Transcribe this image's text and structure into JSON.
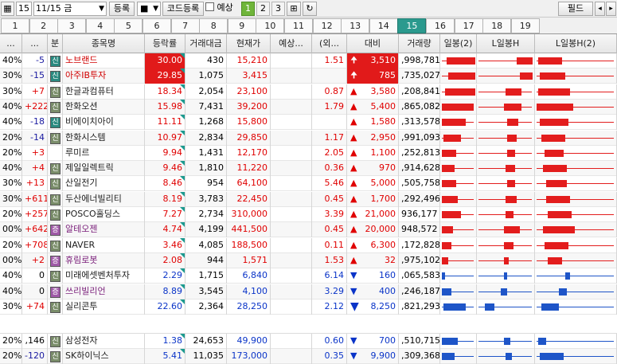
{
  "toolbar": {
    "num": "15",
    "date": "11/15 금",
    "reg": "등록",
    "code_reg": "코드등록",
    "forecast": "예상",
    "pages": [
      "1",
      "2",
      "3"
    ],
    "field": "필드",
    "nav_left": "◂",
    "nav_right": "▸"
  },
  "tabs": [
    "1",
    "2",
    "3",
    "4",
    "5",
    "6",
    "7",
    "8",
    "9",
    "10",
    "11",
    "12",
    "13",
    "14",
    "15",
    "16",
    "17",
    "18",
    "19"
  ],
  "active_tab": "15",
  "headers": [
    "...",
    "...",
    "분",
    "종목명",
    "등락률",
    "거래대금",
    "현재가",
    "예상...",
    "(외...",
    "대비",
    "거래량",
    "일봉(2)",
    "L일봉H",
    "L일봉H(2)"
  ],
  "rows": [
    {
      "a": "40%",
      "b": "-5",
      "t": "신",
      "tc": "g",
      "name": "노브랜드",
      "rate": "30.00",
      "amt": "430",
      "price": "15,210",
      "exp": "",
      "frn": "1.51",
      "arr": "up2",
      "chg": "3,510",
      "vol": ",998,781",
      "rb": true,
      "cls": "up"
    },
    {
      "a": "30%",
      "b": "-15",
      "t": "신",
      "tc": "g",
      "name": "아주IB투자",
      "rate": "29.85",
      "amt": "1,075",
      "price": "3,415",
      "exp": "",
      "frn": "",
      "arr": "up2",
      "chg": "785",
      "vol": ",735,027",
      "rb": true,
      "cls": "up"
    },
    {
      "a": "30%",
      "b": "+7",
      "t": "신",
      "tc": "",
      "name": "한글과컴퓨터",
      "rate": "18.34",
      "amt": "2,054",
      "price": "23,100",
      "exp": "",
      "frn": "0.87",
      "arr": "up",
      "chg": "3,580",
      "vol": ",208,841",
      "rb": false,
      "cls": "up"
    },
    {
      "a": "40%",
      "b": "+222",
      "t": "신",
      "tc": "",
      "name": "한화오션",
      "rate": "15.98",
      "amt": "7,431",
      "price": "39,200",
      "exp": "",
      "frn": "1.79",
      "arr": "up",
      "chg": "5,400",
      "vol": ",865,082",
      "rb": false,
      "cls": "up"
    },
    {
      "a": "40%",
      "b": "-18",
      "t": "신",
      "tc": "g",
      "name": "비에이치아이",
      "rate": "11.11",
      "amt": "1,268",
      "price": "15,800",
      "exp": "",
      "frn": "",
      "arr": "up",
      "chg": "1,580",
      "vol": ",313,578",
      "rb": false,
      "cls": "up"
    },
    {
      "a": "20%",
      "b": "-14",
      "t": "신",
      "tc": "",
      "name": "한화시스템",
      "rate": "10.97",
      "amt": "2,834",
      "price": "29,850",
      "exp": "",
      "frn": "1.17",
      "arr": "up",
      "chg": "2,950",
      "vol": ",991,093",
      "rb": false,
      "cls": "up"
    },
    {
      "a": "20%",
      "b": "+3",
      "t": "",
      "tc": "",
      "name": "루미르",
      "rate": "9.94",
      "amt": "1,431",
      "price": "12,170",
      "exp": "",
      "frn": "2.05",
      "arr": "up",
      "chg": "1,100",
      "vol": ",252,813",
      "rb": false,
      "cls": "up"
    },
    {
      "a": "40%",
      "b": "+4",
      "t": "신",
      "tc": "",
      "name": "제일일렉트릭",
      "rate": "9.46",
      "amt": "1,810",
      "price": "11,220",
      "exp": "",
      "frn": "0.36",
      "arr": "up",
      "chg": "970",
      "vol": ",914,628",
      "rb": false,
      "cls": "up"
    },
    {
      "a": "30%",
      "b": "+13",
      "t": "신",
      "tc": "",
      "name": "산일전기",
      "rate": "8.46",
      "amt": "954",
      "price": "64,100",
      "exp": "",
      "frn": "5.46",
      "arr": "up",
      "chg": "5,000",
      "vol": ",505,758",
      "rb": false,
      "cls": "up"
    },
    {
      "a": "30%",
      "b": "+611",
      "t": "신",
      "tc": "",
      "name": "두산에너빌리티",
      "rate": "8.19",
      "amt": "3,783",
      "price": "22,450",
      "exp": "",
      "frn": "0.45",
      "arr": "up",
      "chg": "1,700",
      "vol": ",292,496",
      "rb": false,
      "cls": "up"
    },
    {
      "a": "20%",
      "b": "+257",
      "t": "신",
      "tc": "",
      "name": "POSCO홀딩스",
      "rate": "7.27",
      "amt": "2,734",
      "price": "310,000",
      "exp": "",
      "frn": "3.39",
      "arr": "up",
      "chg": "21,000",
      "vol": "936,177",
      "rb": false,
      "cls": "up"
    },
    {
      "a": "00%",
      "b": "+642",
      "t": "증",
      "tc": "m",
      "name": "알테오젠",
      "rate": "4.74",
      "amt": "4,199",
      "price": "441,500",
      "exp": "",
      "frn": "0.45",
      "arr": "up",
      "chg": "20,000",
      "vol": "948,572",
      "rb": false,
      "cls": "up"
    },
    {
      "a": "20%",
      "b": "+708",
      "t": "신",
      "tc": "",
      "name": "NAVER",
      "rate": "3.46",
      "amt": "4,085",
      "price": "188,500",
      "exp": "",
      "frn": "0.11",
      "arr": "up",
      "chg": "6,300",
      "vol": ",172,828",
      "rb": false,
      "cls": "up"
    },
    {
      "a": "00%",
      "b": "+2",
      "t": "증",
      "tc": "m",
      "name": "휴림로봇",
      "rate": "2.08",
      "amt": "944",
      "price": "1,571",
      "exp": "",
      "frn": "1.53",
      "arr": "up",
      "chg": "32",
      "vol": ",975,102",
      "rb": false,
      "cls": "up"
    },
    {
      "a": "40%",
      "b": "0",
      "t": "신",
      "tc": "",
      "name": "미래에셋벤처투자",
      "rate": "2.29",
      "amt": "1,715",
      "price": "6,840",
      "exp": "",
      "frn": "6.14",
      "arr": "dn",
      "chg": "160",
      "vol": ",065,583",
      "rb": false,
      "cls": "dn"
    },
    {
      "a": "40%",
      "b": "0",
      "t": "증",
      "tc": "m",
      "name": "쓰리빌리언",
      "rate": "8.89",
      "amt": "3,545",
      "price": "4,100",
      "exp": "",
      "frn": "3.29",
      "arr": "dn",
      "chg": "400",
      "vol": ",246,187",
      "rb": false,
      "cls": "dn"
    },
    {
      "a": "30%",
      "b": "+74",
      "t": "신",
      "tc": "",
      "name": "실리콘투",
      "rate": "22.60",
      "amt": "2,364",
      "price": "28,250",
      "exp": "",
      "frn": "2.12",
      "arr": "dn2",
      "chg": "8,250",
      "vol": ",821,293",
      "rb": false,
      "cls": "dn"
    }
  ],
  "rows2": [
    {
      "a": "20%",
      "b": ",146",
      "t": "신",
      "tc": "",
      "name": "삼성전자",
      "rate": "1.38",
      "amt": "24,653",
      "price": "49,900",
      "exp": "",
      "frn": "0.60",
      "arr": "dn",
      "chg": "700",
      "vol": ",510,715",
      "rb": false,
      "cls": "dn"
    },
    {
      "a": "20%",
      "b": "-120",
      "t": "신",
      "tc": "",
      "name": "SK하이닉스",
      "rate": "5.41",
      "amt": "11,035",
      "price": "173,000",
      "exp": "",
      "frn": "0.35",
      "arr": "dn",
      "chg": "9,900",
      "vol": ",309,368",
      "rb": false,
      "cls": "dn"
    }
  ],
  "colors": {
    "up": "#e00000",
    "down": "#0a34c8",
    "active_tab": "#2b9a8e",
    "active_page": "#6fb53a"
  }
}
